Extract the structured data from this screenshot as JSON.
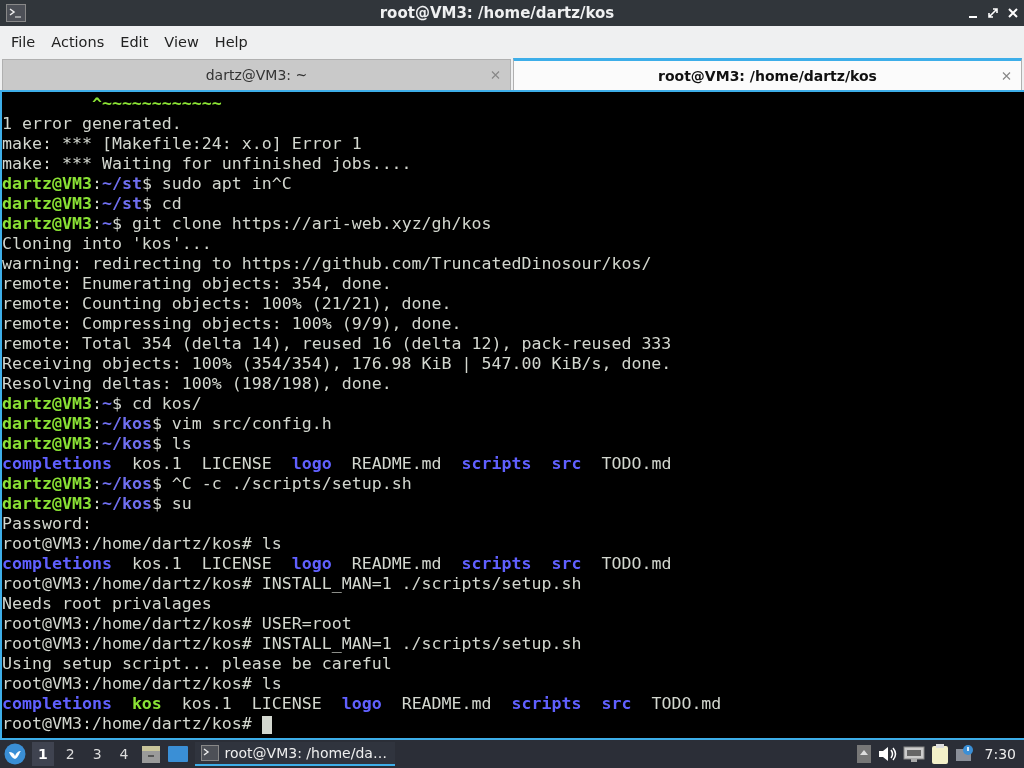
{
  "window": {
    "title": "root@VM3: /home/dartz/kos"
  },
  "menu": [
    "File",
    "Actions",
    "Edit",
    "View",
    "Help"
  ],
  "tabs": [
    {
      "label": "dartz@VM3: ~",
      "selected": false
    },
    {
      "label": "root@VM3: /home/dartz/kos",
      "selected": true
    }
  ],
  "terminal": {
    "lines": [
      [
        {
          "text": "         ^~~~~~~~~~~~~",
          "kind": "caret"
        }
      ],
      [
        {
          "text": "1 error generated.",
          "kind": "text"
        }
      ],
      [
        {
          "text": "make: *** [Makefile:24: x.o] Error 1",
          "kind": "text"
        }
      ],
      [
        {
          "text": "make: *** Waiting for unfinished jobs....",
          "kind": "text"
        }
      ],
      [
        {
          "text": "dartz@VM3",
          "kind": "user"
        },
        {
          "text": ":",
          "kind": "text"
        },
        {
          "text": "~/st",
          "kind": "path"
        },
        {
          "text": "$ sudo apt in^C",
          "kind": "text"
        }
      ],
      [
        {
          "text": "dartz@VM3",
          "kind": "user"
        },
        {
          "text": ":",
          "kind": "text"
        },
        {
          "text": "~/st",
          "kind": "path"
        },
        {
          "text": "$ cd",
          "kind": "text"
        }
      ],
      [
        {
          "text": "dartz@VM3",
          "kind": "user"
        },
        {
          "text": ":",
          "kind": "text"
        },
        {
          "text": "~",
          "kind": "path"
        },
        {
          "text": "$ git clone https://ari-web.xyz/gh/kos",
          "kind": "text"
        }
      ],
      [
        {
          "text": "Cloning into 'kos'...",
          "kind": "text"
        }
      ],
      [
        {
          "text": "warning: redirecting to https://github.com/TruncatedDinosour/kos/",
          "kind": "text"
        }
      ],
      [
        {
          "text": "remote: Enumerating objects: 354, done.",
          "kind": "text"
        }
      ],
      [
        {
          "text": "remote: Counting objects: 100% (21/21), done.",
          "kind": "text"
        }
      ],
      [
        {
          "text": "remote: Compressing objects: 100% (9/9), done.",
          "kind": "text"
        }
      ],
      [
        {
          "text": "remote: Total 354 (delta 14), reused 16 (delta 12), pack-reused 333",
          "kind": "text"
        }
      ],
      [
        {
          "text": "Receiving objects: 100% (354/354), 176.98 KiB | 547.00 KiB/s, done.",
          "kind": "text"
        }
      ],
      [
        {
          "text": "Resolving deltas: 100% (198/198), done.",
          "kind": "text"
        }
      ],
      [
        {
          "text": "dartz@VM3",
          "kind": "user"
        },
        {
          "text": ":",
          "kind": "text"
        },
        {
          "text": "~",
          "kind": "path"
        },
        {
          "text": "$ cd kos/",
          "kind": "text"
        }
      ],
      [
        {
          "text": "dartz@VM3",
          "kind": "user"
        },
        {
          "text": ":",
          "kind": "text"
        },
        {
          "text": "~/kos",
          "kind": "path"
        },
        {
          "text": "$ vim src/config.h",
          "kind": "text"
        }
      ],
      [
        {
          "text": "dartz@VM3",
          "kind": "user"
        },
        {
          "text": ":",
          "kind": "text"
        },
        {
          "text": "~/kos",
          "kind": "path"
        },
        {
          "text": "$ ls",
          "kind": "text"
        }
      ],
      [
        {
          "text": "completions",
          "kind": "dir"
        },
        {
          "text": "  kos.1  LICENSE  ",
          "kind": "text"
        },
        {
          "text": "logo",
          "kind": "dir"
        },
        {
          "text": "  README.md  ",
          "kind": "text"
        },
        {
          "text": "scripts  ",
          "kind": "dir"
        },
        {
          "text": "src",
          "kind": "dir"
        },
        {
          "text": "  TODO.md",
          "kind": "text"
        }
      ],
      [
        {
          "text": "dartz@VM3",
          "kind": "user"
        },
        {
          "text": ":",
          "kind": "text"
        },
        {
          "text": "~/kos",
          "kind": "path"
        },
        {
          "text": "$ ^C -c ./scripts/setup.sh",
          "kind": "text"
        }
      ],
      [
        {
          "text": "dartz@VM3",
          "kind": "user"
        },
        {
          "text": ":",
          "kind": "text"
        },
        {
          "text": "~/kos",
          "kind": "path"
        },
        {
          "text": "$ su",
          "kind": "text"
        }
      ],
      [
        {
          "text": "Password:",
          "kind": "text"
        }
      ],
      [
        {
          "text": "root@VM3:/home/dartz/kos# ls",
          "kind": "text"
        }
      ],
      [
        {
          "text": "completions",
          "kind": "dir"
        },
        {
          "text": "  kos.1  LICENSE  ",
          "kind": "text"
        },
        {
          "text": "logo",
          "kind": "dir"
        },
        {
          "text": "  README.md  ",
          "kind": "text"
        },
        {
          "text": "scripts  ",
          "kind": "dir"
        },
        {
          "text": "src",
          "kind": "dir"
        },
        {
          "text": "  TODO.md",
          "kind": "text"
        }
      ],
      [
        {
          "text": "root@VM3:/home/dartz/kos# INSTALL_MAN=1 ./scripts/setup.sh",
          "kind": "text"
        }
      ],
      [
        {
          "text": "Needs root privalages",
          "kind": "text"
        }
      ],
      [
        {
          "text": "root@VM3:/home/dartz/kos# USER=root",
          "kind": "text"
        }
      ],
      [
        {
          "text": "root@VM3:/home/dartz/kos# INSTALL_MAN=1 ./scripts/setup.sh",
          "kind": "text"
        }
      ],
      [
        {
          "text": "Using setup script... please be careful",
          "kind": "text"
        }
      ],
      [
        {
          "text": "root@VM3:/home/dartz/kos# ls",
          "kind": "text"
        }
      ],
      [
        {
          "text": "completions  ",
          "kind": "dir"
        },
        {
          "text": "kos",
          "kind": "exec"
        },
        {
          "text": "  kos.1  LICENSE  ",
          "kind": "text"
        },
        {
          "text": "logo",
          "kind": "dir"
        },
        {
          "text": "  README.md  ",
          "kind": "text"
        },
        {
          "text": "scripts  ",
          "kind": "dir"
        },
        {
          "text": "src",
          "kind": "dir"
        },
        {
          "text": "  TODO.md",
          "kind": "text"
        }
      ],
      [
        {
          "text": "root@VM3:/home/dartz/kos# ",
          "kind": "text"
        }
      ]
    ]
  },
  "taskbar": {
    "workspaces": [
      {
        "label": "1",
        "selected": true
      },
      {
        "label": "2",
        "selected": false
      },
      {
        "label": "3",
        "selected": false
      },
      {
        "label": "4",
        "selected": false
      }
    ],
    "task": {
      "label": "root@VM3: /home/da…",
      "selected": true
    },
    "clock": "7:30"
  }
}
